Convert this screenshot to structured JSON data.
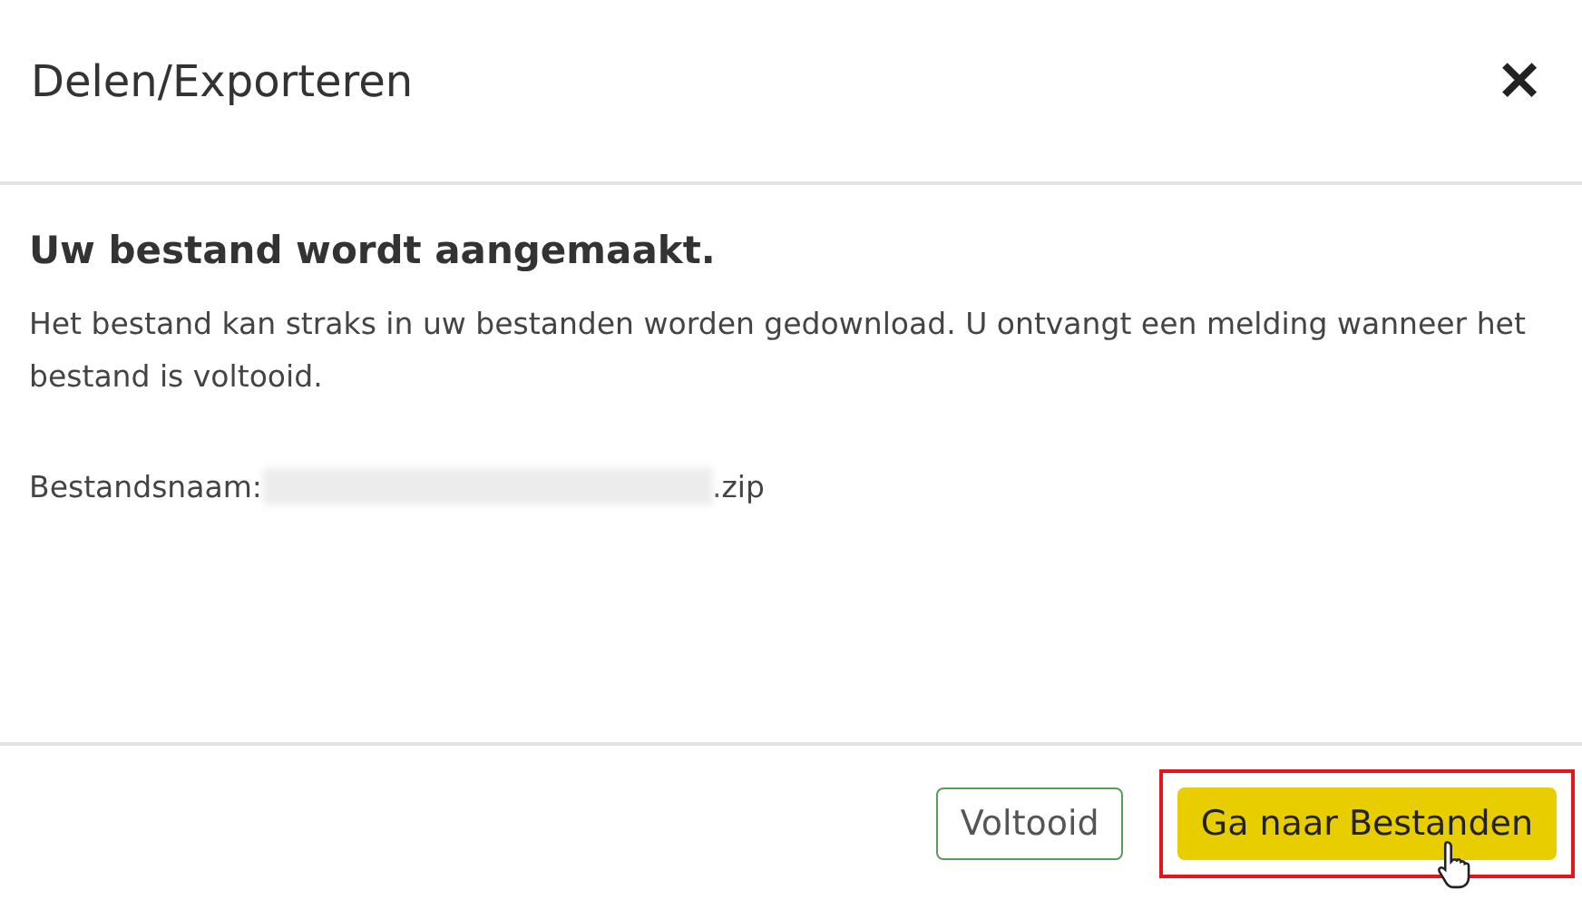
{
  "dialog": {
    "title": "Delen/Exporteren",
    "close": "✕"
  },
  "body": {
    "heading": "Uw bestand wordt aangemaakt.",
    "message": "Het bestand kan straks in uw bestanden worden gedownload. U ontvangt een melding wanneer het bestand is voltooid.",
    "filename_label": "Bestandsnaam:",
    "filename_redacted": true,
    "filename_suffix": ".zip"
  },
  "buttons": [
    {
      "label": "Voltooid",
      "kind": "secondary",
      "highlighted": false
    },
    {
      "label": "Ga naar Bestanden",
      "kind": "primary",
      "highlighted": true
    }
  ]
}
